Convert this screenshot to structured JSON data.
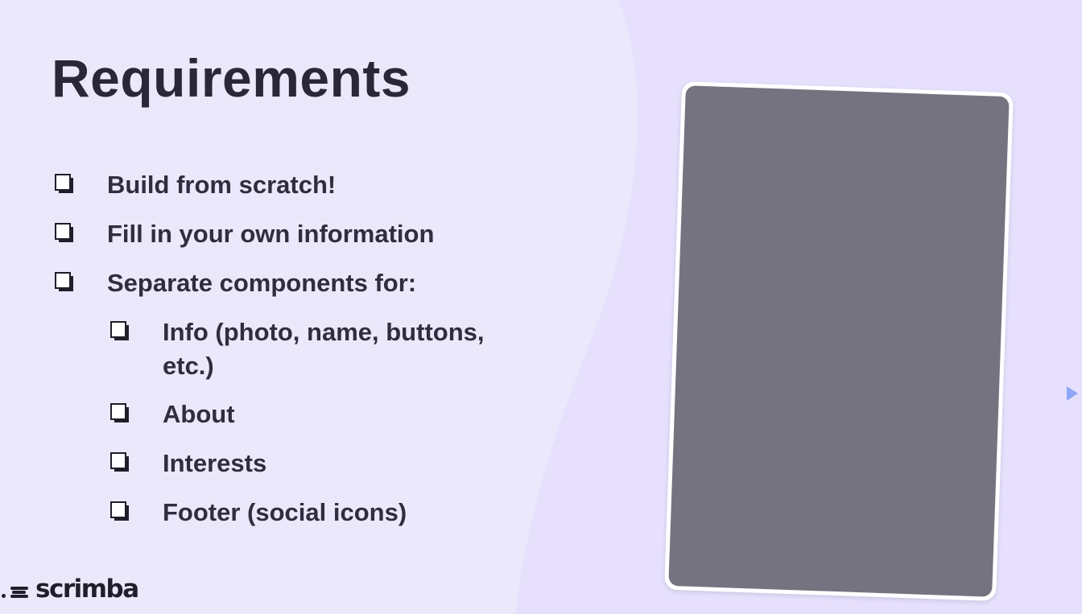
{
  "slide": {
    "title": "Requirements",
    "items": [
      {
        "label": "Build from scratch!",
        "level": 1
      },
      {
        "label": "Fill in your own information",
        "level": 1
      },
      {
        "label": "Separate components for:",
        "level": 1
      },
      {
        "label": "Info (photo, name, buttons, etc.)",
        "level": 2
      },
      {
        "label": "About",
        "level": 2
      },
      {
        "label": "Interests",
        "level": 2
      },
      {
        "label": "Footer (social icons)",
        "level": 2
      }
    ]
  },
  "branding": {
    "logo_text": "scrimba"
  },
  "colors": {
    "background_left": "#ece8fc",
    "background_right": "#e6e0fd",
    "text": "#2f2d3f",
    "card_frame": "#ffffff",
    "card_screen": "#75737f",
    "cursor": "#8ea6f6"
  },
  "icons": {
    "checkbox": "checkbox-icon",
    "cursor": "pointer-arrow-icon",
    "logo": "scrimba-logo-mark"
  }
}
